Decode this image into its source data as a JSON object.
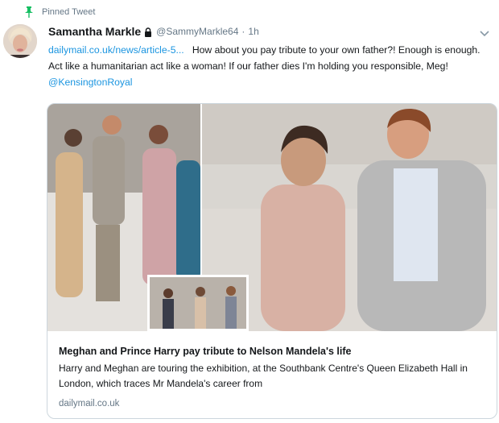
{
  "pinned": {
    "label": "Pinned Tweet"
  },
  "author": {
    "name": "Samantha Markle",
    "handle": "@SammyMarkle64",
    "separator": "·",
    "time": "1h"
  },
  "tweet": {
    "link": "dailymail.co.uk/news/article-5...",
    "text": "How about you pay tribute to your own father?! Enough is enough. Act like a humanitarian act like a woman! If our father dies I'm holding you responsible, Meg!",
    "mention": "@KensingtonRoyal"
  },
  "card": {
    "title": "Meghan and Prince Harry pay tribute to Nelson Mandela's life",
    "description": "Harry and Meghan are touring the exhibition, at the Southbank Centre's Queen Elizabeth Hall in London, which traces Mr Mandela's career from",
    "domain": "dailymail.co.uk"
  },
  "icons": {
    "pin": "pin-icon",
    "lock": "lock-icon",
    "caret": "chevron-down-icon"
  },
  "colors": {
    "link": "#1b95e0",
    "secondary_text": "#657786",
    "pin": "#17bf63",
    "border": "#ccd6dd"
  }
}
